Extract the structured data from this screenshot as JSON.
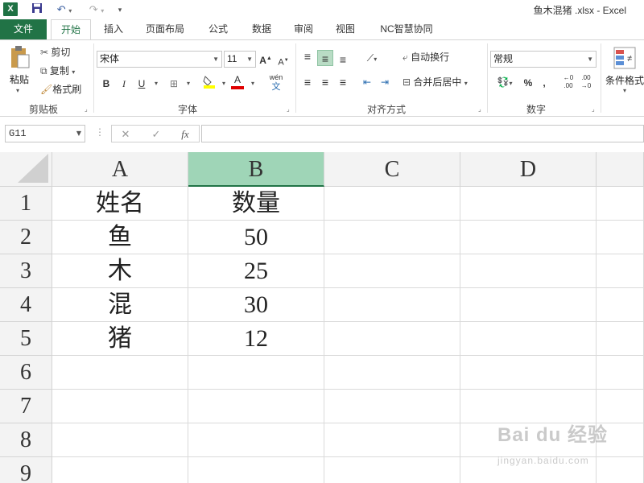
{
  "titlebar": {
    "app_icon": "X",
    "title": "鱼木混猪 .xlsx - Excel",
    "icons": [
      "save-icon",
      "undo-icon",
      "redo-icon",
      "customize-qat-icon"
    ]
  },
  "tabs": [
    {
      "label": "文件"
    },
    {
      "label": "开始"
    },
    {
      "label": "插入"
    },
    {
      "label": "页面布局"
    },
    {
      "label": "公式"
    },
    {
      "label": "数据"
    },
    {
      "label": "审阅"
    },
    {
      "label": "视图"
    },
    {
      "label": "NC智慧协同"
    }
  ],
  "ribbon": {
    "clipboard": {
      "paste": "粘贴",
      "cut": "剪切",
      "copy": "复制",
      "format_painter": "格式刷",
      "label": "剪贴板"
    },
    "font": {
      "font_name": "宋体",
      "font_size": "11",
      "bold": "B",
      "italic": "I",
      "underline": "U",
      "phonetic": "wén",
      "grow": "A",
      "shrink": "A",
      "font_color": "A",
      "label": "字体"
    },
    "alignment": {
      "wrap_text": "自动换行",
      "merge_center": "合并后居中",
      "label": "对齐方式"
    },
    "number": {
      "format": "常规",
      "percent": "%",
      "comma": ",",
      "label": "数字"
    },
    "styles": {
      "conditional_formatting": "条件格式"
    }
  },
  "formula_bar": {
    "name_box": "G11",
    "cancel": "✕",
    "enter": "✓",
    "fx": "fx",
    "content": ""
  },
  "grid": {
    "columns": [
      "A",
      "B",
      "C",
      "D"
    ],
    "selected_column": "B",
    "rows": [
      "1",
      "2",
      "3",
      "4",
      "5",
      "6",
      "7",
      "8",
      "9"
    ],
    "cells": [
      {
        "A": "姓名",
        "B": "数量"
      },
      {
        "A": "鱼",
        "B": "50"
      },
      {
        "A": "木",
        "B": "25"
      },
      {
        "A": "混",
        "B": "30"
      },
      {
        "A": "猪",
        "B": "12"
      },
      {
        "A": "",
        "B": ""
      },
      {
        "A": "",
        "B": ""
      },
      {
        "A": "",
        "B": ""
      },
      {
        "A": "",
        "B": ""
      }
    ]
  },
  "watermark": {
    "line1": "Bai du 经验",
    "line2": "jingyan.baidu.com"
  },
  "colors": {
    "excel_green": "#217346",
    "selected_header": "#9fd5b7"
  }
}
